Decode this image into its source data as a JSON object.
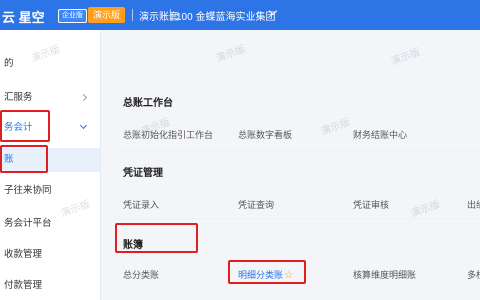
{
  "topbar": {
    "logo": "云 星空",
    "badge": "企业版",
    "demo_label": "演示版",
    "account": "演示账套",
    "company": "100 金蝶蓝海实业集团"
  },
  "sidebar": {
    "items": [
      {
        "label": "的"
      },
      {
        "label": "汇服务"
      },
      {
        "label": "务会计"
      },
      {
        "label": "账"
      },
      {
        "label": "子往来协同"
      },
      {
        "label": "务会计平台"
      },
      {
        "label": "收款管理"
      },
      {
        "label": "付款管理"
      }
    ]
  },
  "main": {
    "sections": [
      {
        "title": "总账工作台",
        "links": [
          "总账初始化指引工作台",
          "总账数字看板",
          "财务结账中心"
        ]
      },
      {
        "title": "凭证管理",
        "links": [
          "凭证录入",
          "凭证查询",
          "凭证审核",
          "出纳"
        ]
      },
      {
        "title": "账簿",
        "links": [
          "总分类账",
          "明细分类账",
          "核算维度明细账",
          "多栏"
        ]
      }
    ]
  },
  "watermark": "演示版",
  "colors": {
    "brand": "#2d74e6",
    "highlight": "#e02020",
    "demo": "#ff9f1c"
  }
}
